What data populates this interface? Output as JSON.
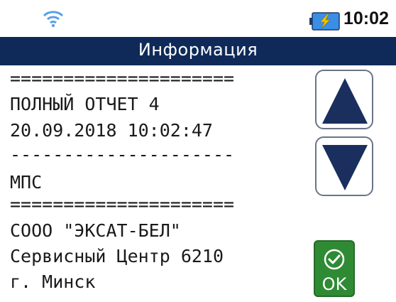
{
  "status_bar": {
    "time": "10:02",
    "wifi_icon": "wifi-icon",
    "battery_icon": "battery-charging-icon"
  },
  "header": {
    "title": "Информация"
  },
  "report": {
    "lines": [
      "=====================",
      "ПОЛНЫЙ ОТЧЕТ 4",
      "20.09.2018 10:02:47",
      "---------------------",
      "МПС",
      "=====================",
      "СООО \"ЭКСАТ-БЕЛ\"",
      "Сервисный Центр 6210",
      "г. Минск"
    ]
  },
  "controls": {
    "scroll_up_icon": "arrow-up-icon",
    "scroll_down_icon": "arrow-down-icon",
    "ok_label": "OK",
    "ok_icon": "check-circle-icon"
  },
  "colors": {
    "header_bg": "#0f2a59",
    "arrow": "#1a2f5e",
    "ok_bg": "#2f8a34",
    "battery_fill": "#3a8ee6",
    "battery_bolt": "#f2c200"
  }
}
